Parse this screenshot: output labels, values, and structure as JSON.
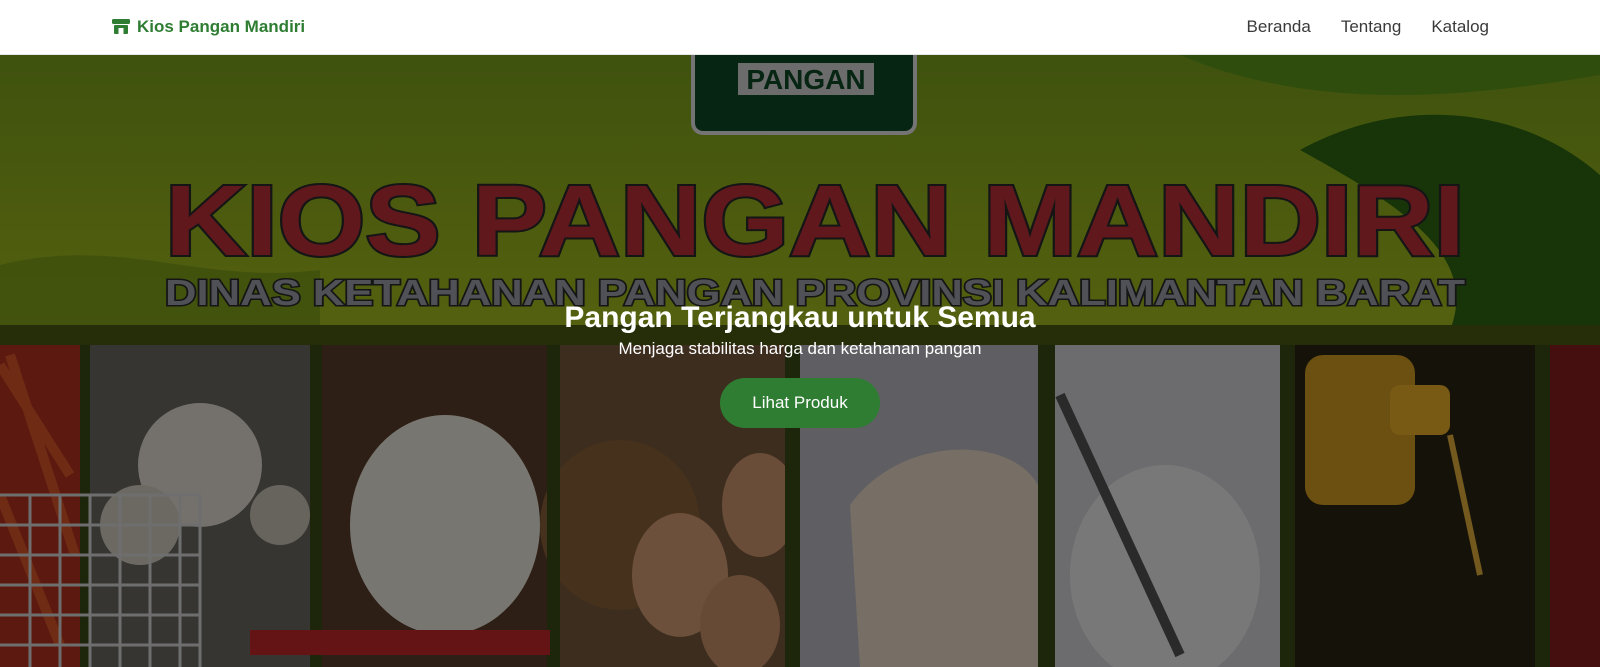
{
  "navbar": {
    "brand": {
      "icon": "store-icon",
      "text": "Kios Pangan Mandiri"
    },
    "links": [
      {
        "label": "Beranda"
      },
      {
        "label": "Tentang"
      },
      {
        "label": "Katalog"
      }
    ]
  },
  "hero": {
    "banner": {
      "badge_text": "PANGAN",
      "title": "KIOS PANGAN MANDIRI",
      "subtitle": "DINAS KETAHANAN PANGAN PROVINSI KALIMANTAN BARAT"
    },
    "heading": "Pangan Terjangkau untuk Semua",
    "subheading": "Menjaga stabilitas harga dan ketahanan pangan",
    "cta_label": "Lihat Produk"
  },
  "colors": {
    "brand_green": "#2e7d32",
    "banner_red": "#c0313a",
    "banner_yellow_green": "#a8c21d"
  }
}
